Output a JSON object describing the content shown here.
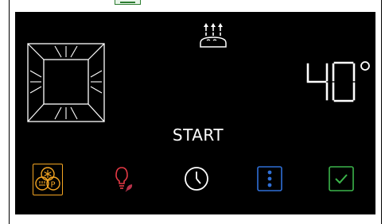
{
  "app": {
    "start_label": "START",
    "temperature": "40",
    "temperature_unit": "°"
  },
  "icons": {
    "oven": "oven-heating-icon",
    "proof": "dough-proofing-icon",
    "mode": "proof-fan-mode-icon",
    "light": "lamp-eco-icon",
    "timer": "clock-icon",
    "menu": "vertical-dots-menu-icon",
    "confirm": "checkbox-icon"
  },
  "colors": {
    "background": "#000000",
    "text": "#ffffff",
    "mode_accent": "#f5a623",
    "light_accent": "#e53945",
    "eco_accent": "#b8324a",
    "menu_accent": "#2f6fd6",
    "confirm_accent": "#3bb44a",
    "top_indicator": "#2e7d32"
  }
}
